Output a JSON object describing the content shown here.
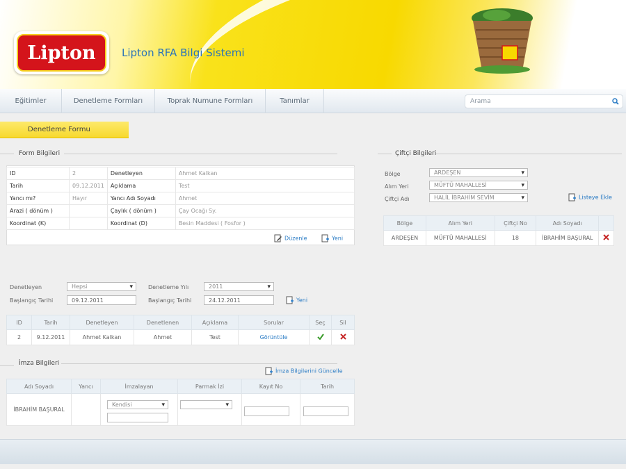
{
  "brand": {
    "logo_text": "Lipton",
    "app_title": "Lipton RFA Bilgi Sistemi",
    "colors": {
      "yellow": "#f8d900",
      "red": "#d4141b",
      "link": "#2b7cc5"
    }
  },
  "nav": {
    "items": [
      "Eğitimler",
      "Denetleme Formları",
      "Toprak Numune Formları",
      "Tanımlar"
    ],
    "search_placeholder": "Arama"
  },
  "page_tab": "Denetleme Formu",
  "form": {
    "legend": "Form Bilgileri",
    "rows": [
      {
        "k1": "ID",
        "v1": "2",
        "k2": "Denetleyen",
        "v2": "Ahmet Kalkan"
      },
      {
        "k1": "Tarih",
        "v1": "09.12.2011",
        "k2": "Açıklama",
        "v2": "Test"
      },
      {
        "k1": "Yancı mı?",
        "v1": "Hayır",
        "k2": "Yancı Adı Soyadı",
        "v2": "Ahmet"
      },
      {
        "k1": "Arazi ( dönüm )",
        "v1": "",
        "k2": "Çaylık ( dönüm )",
        "v2": "Çay Ocağı Sy."
      },
      {
        "k1": "Koordinat (K)",
        "v1": "",
        "k2": "Koordinat (D)",
        "v2": "Besin Maddesi ( Fosfor )"
      }
    ],
    "edit_label": "Düzenle",
    "new_label": "Yeni"
  },
  "farmer": {
    "legend": "Çiftçi Bilgileri",
    "bolge_label": "Bölge",
    "bolge_value": "ARDEŞEN",
    "alim_label": "Alım Yeri",
    "alim_value": "MÜFTÜ MAHALLESİ",
    "ciftci_label": "Çiftçi Adı",
    "ciftci_value": "HALİL İBRAHİM SEVİM",
    "add_label": "Listeye Ekle",
    "headers": [
      "Bölge",
      "Alım Yeri",
      "Çiftçi No",
      "Adı Soyadı"
    ],
    "rows": [
      {
        "bolge": "ARDEŞEN",
        "alim": "MÜFTÜ MAHALLESİ",
        "no": "18",
        "ad": "İBRAHİM BAŞURAL"
      }
    ]
  },
  "filter": {
    "denetleyen_label": "Denetleyen",
    "denetleyen_value": "Hepsi",
    "yil_label": "Denetleme Yılı",
    "yil_value": "2011",
    "bas1_label": "Başlangıç Tarihi",
    "bas1_value": "09.12.2011",
    "bas2_label": "Başlangıç Tarihi",
    "bas2_value": "24.12.2011",
    "new_label": "Yeni"
  },
  "audits": {
    "headers": [
      "ID",
      "Tarih",
      "Denetleyen",
      "Denetlenen",
      "Açıklama",
      "Sorular",
      "Seç",
      "Sil"
    ],
    "rows": [
      {
        "id": "2",
        "tarih": "9.12.2011",
        "denetleyen": "Ahmet Kalkan",
        "denetlenen": "Ahmet",
        "aciklama": "Test",
        "sorular": "Görüntüle"
      }
    ]
  },
  "signature": {
    "legend": "İmza Bilgileri",
    "update_label": "İmza Bilgilerini Güncelle",
    "headers": [
      "Adı Soyadı",
      "Yancı",
      "İmzalayan",
      "Parmak İzi",
      "Kayıt No",
      "Tarih"
    ],
    "row": {
      "ad": "İBRAHİM BAŞURAL",
      "imzalayan": "Kendisi",
      "parmak": ""
    }
  }
}
